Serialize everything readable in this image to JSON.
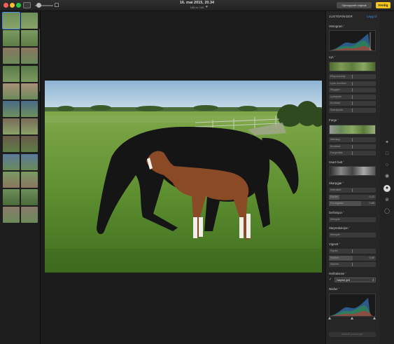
{
  "window": {
    "title_date": "16. mai 2015, 20.34",
    "title_count": "166 av 166"
  },
  "toolbar": {
    "original_label": "Gjenopprett original",
    "done_label": "Ferdig"
  },
  "panel": {
    "title": "JUSTERINGER",
    "add_label": "Legg til",
    "histogram_label": "Histogram ˇ",
    "light": {
      "label": "Lys ˇ",
      "rows": [
        "Eksponering",
        "Lyse områder",
        "Skygger",
        "Lysstyrke",
        "Kontrast",
        "Svartpunkt"
      ]
    },
    "color": {
      "label": "Farge ˇ",
      "rows": [
        "Metning",
        "Kontrast",
        "Fargestikk"
      ]
    },
    "bw": {
      "label": "Svart-hvitt ˇ"
    },
    "sharpen": {
      "label": "Skarpgjør ˇ",
      "rows": [
        {
          "name": "Intensitet",
          "value": ""
        },
        {
          "name": "Kanter",
          "value": "0,22"
        },
        {
          "name": "Formgjalse",
          "value": "0,68"
        }
      ]
    },
    "definition": {
      "label": "Definisjon ˇ",
      "row": "Mengde"
    },
    "noise": {
      "label": "Støyreduksjon ˇ",
      "row": "Mengde"
    },
    "vignette": {
      "label": "Vignett ˇ",
      "rows": [
        {
          "name": "Styrke",
          "value": ""
        },
        {
          "name": "Radius",
          "value": "0,50"
        },
        {
          "name": "Mykhet",
          "value": ""
        }
      ]
    },
    "white_balance": {
      "label": "Hvitbalanse ˇ",
      "option": "Nøytral grå"
    },
    "levels": {
      "label": "Nivåer ˇ"
    },
    "reset_label": "Nullstill justeringer"
  },
  "colors": {
    "accent": "#4a90e2",
    "done": "#f5c518",
    "panel_bg": "#262626"
  },
  "icons": [
    "wand-icon",
    "crop-icon",
    "filters-icon",
    "adjust-icon",
    "retouch-icon",
    "redeye-icon"
  ]
}
